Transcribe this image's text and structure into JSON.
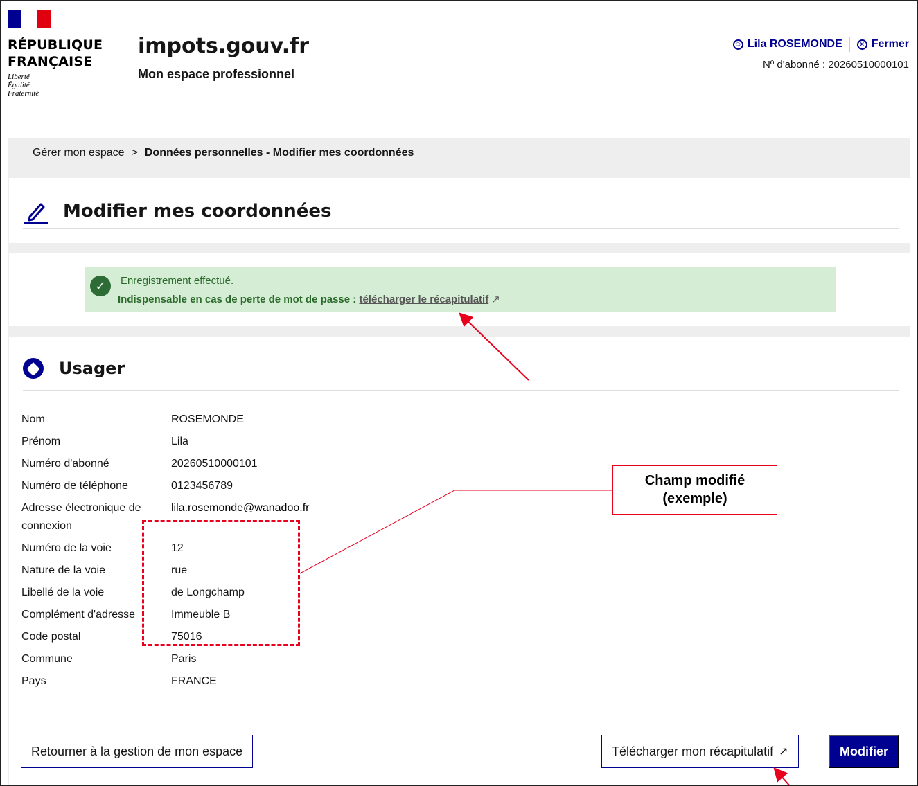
{
  "header": {
    "republic_line1": "RÉPUBLIQUE",
    "republic_line2": "FRANÇAISE",
    "motto": [
      "Liberté",
      "Égalité",
      "Fraternité"
    ],
    "site_title": "impots.gouv.fr",
    "site_subtitle": "Mon espace professionnel",
    "user_name": "Lila ROSEMONDE",
    "close_label": "Fermer",
    "subscriber_line": "Nº d'abonné : 20260510000101"
  },
  "breadcrumb": {
    "parent": "Gérer mon espace",
    "separator": ">",
    "current": "Données personnelles - Modifier mes coordonnées"
  },
  "page": {
    "title": "Modifier mes coordonnées"
  },
  "alert": {
    "line1": "Enregistrement effectué.",
    "line2_prefix": "Indispensable en cas de perte de mot de passe :",
    "link_label": "télécharger le récapitulatif",
    "status_color": "#2d6c34"
  },
  "section": {
    "title": "Usager",
    "rows": [
      {
        "label": "Nom",
        "value": "ROSEMONDE"
      },
      {
        "label": "Prénom",
        "value": "Lila"
      },
      {
        "label": "Numéro d'abonné",
        "value": "20260510000101"
      },
      {
        "label": "Numéro de téléphone",
        "value": "0123456789"
      },
      {
        "label": "Adresse électronique de connexion",
        "value": "lila.rosemonde@wanadoo.fr"
      },
      {
        "label": "Numéro de la voie",
        "value": "12"
      },
      {
        "label": "Nature de la voie",
        "value": "rue"
      },
      {
        "label": "Libellé de la voie",
        "value": "de Longchamp"
      },
      {
        "label": "Complément d'adresse",
        "value": "Immeuble B"
      },
      {
        "label": "Code postal",
        "value": "75016"
      },
      {
        "label": "Commune",
        "value": "Paris"
      },
      {
        "label": "Pays",
        "value": "FRANCE"
      }
    ]
  },
  "buttons": {
    "back": "Retourner à la gestion de mon espace",
    "download": "Télécharger mon récapitulatif",
    "modify": "Modifier"
  },
  "annotation": {
    "callout": "Champ modifié (exemple)",
    "color": "#e8001c"
  },
  "colors": {
    "primary": "#000091",
    "success_bg": "#d4edd4",
    "band": "#eeeeee"
  }
}
